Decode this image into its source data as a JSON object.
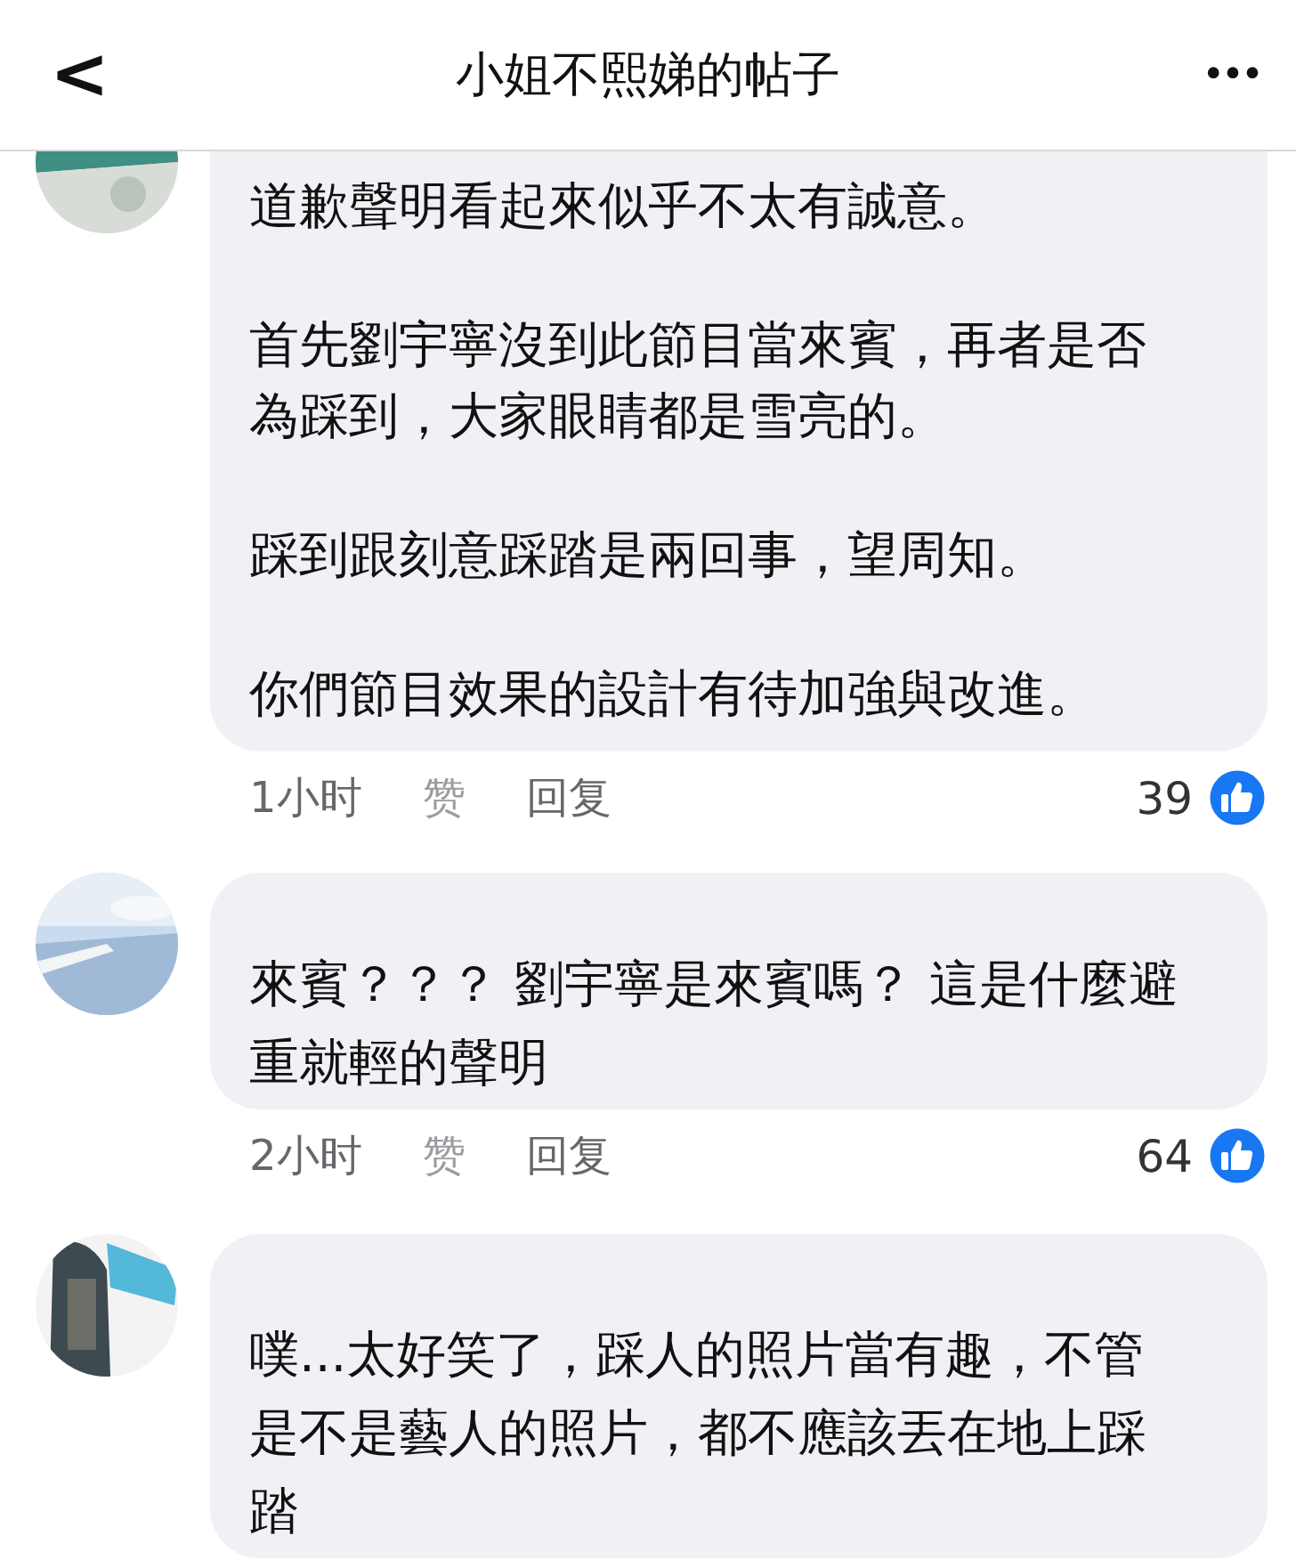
{
  "header": {
    "title": "小姐不熙娣的帖子",
    "back": "<",
    "more": "•••"
  },
  "comments": [
    {
      "avatar": {
        "kind": "picture"
      },
      "paragraphs": [
        [
          "道歉聲明看起來似乎不太有誠意。"
        ],
        [
          "首先劉宇寧沒到此節目當來賓，再者是否",
          "為踩到，大家眼睛都是雪亮的。"
        ],
        [
          "踩到跟刻意踩踏是兩回事，望周知。"
        ],
        [
          "你們節目效果的設計有待加強與改進。"
        ]
      ],
      "time": "1小时",
      "like": "赞",
      "reply": "回复",
      "reactions": "39"
    },
    {
      "avatar": {
        "kind": "picture"
      },
      "paragraphs": [
        [
          "來賓？？？ 劉宇寧是來賓嗎？ 這是什麼避",
          "重就輕的聲明"
        ]
      ],
      "time": "2小时",
      "like": "赞",
      "reply": "回复",
      "reactions": "64"
    },
    {
      "avatar": {
        "kind": "picture"
      },
      "paragraphs": [
        [
          "噗...太好笑了，踩人的照片當有趣，不管",
          "是不是藝人的照片，都不應該丟在地上踩",
          "踏"
        ]
      ]
    }
  ]
}
